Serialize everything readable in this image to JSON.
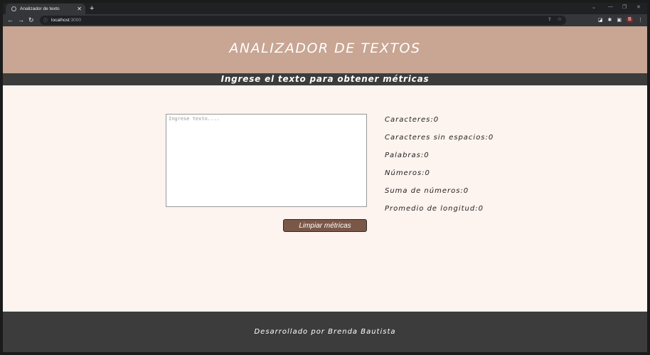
{
  "browser": {
    "tab_title": "Analizador de texto",
    "tab_close": "✕",
    "new_tab": "+",
    "url_host": "localhost",
    "url_port": ":3000",
    "window_controls": [
      "⌄",
      "—",
      "❐",
      "✕"
    ],
    "profile_initial": "B"
  },
  "header": {
    "title": "ANALIZADOR DE TEXTOS",
    "subtitle": "Ingrese el texto para obtener métricas"
  },
  "editor": {
    "placeholder": "Ingrese texto....",
    "value": ""
  },
  "actions": {
    "clear_label": "Limpiar métricas"
  },
  "metrics": [
    {
      "label": "Caracteres:",
      "value": "0"
    },
    {
      "label": "Caracteres sin espacios:",
      "value": "0"
    },
    {
      "label": "Palabras:",
      "value": "0"
    },
    {
      "label": "Números:",
      "value": "0"
    },
    {
      "label": "Suma de números:",
      "value": "0"
    },
    {
      "label": "Promedio de longitud:",
      "value": "0"
    }
  ],
  "footer": {
    "text": "Desarrollado por Brenda Bautista"
  },
  "colors": {
    "hero": "#c8a693",
    "bars": "#3c3c3c",
    "page": "#fdf3ef",
    "button": "#7a5848"
  }
}
